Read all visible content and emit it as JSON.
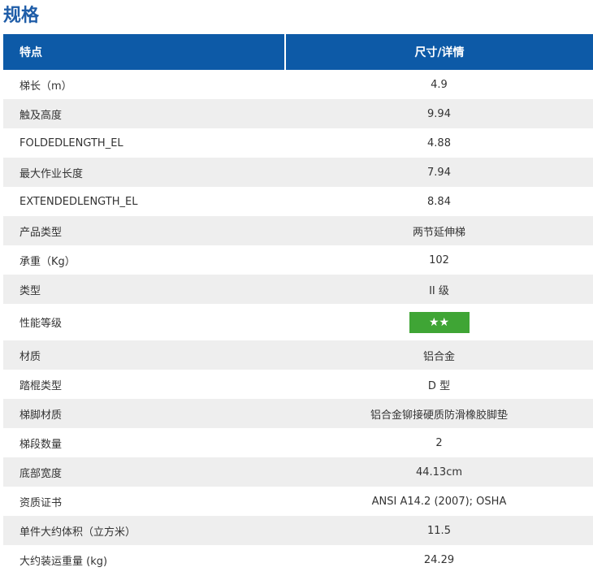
{
  "page_title": "规格",
  "table": {
    "header_feature": "特点",
    "header_detail": "尺寸/详情",
    "rows": [
      {
        "feature": "梯长（m）",
        "detail": "4.9"
      },
      {
        "feature": "触及高度",
        "detail": "9.94"
      },
      {
        "feature": "FOLDEDLENGTH_EL",
        "detail": "4.88"
      },
      {
        "feature": "最大作业长度",
        "detail": "7.94"
      },
      {
        "feature": "EXTENDEDLENGTH_EL",
        "detail": "8.84"
      },
      {
        "feature": "产品类型",
        "detail": "两节延伸梯"
      },
      {
        "feature": "承重（Kg）",
        "detail": "102"
      },
      {
        "feature": "类型",
        "detail": "II 级"
      },
      {
        "feature": "性能等级",
        "detail": "★★",
        "rating_color": "#3fa535",
        "rating_stars": 2
      },
      {
        "feature": "材质",
        "detail": "铝合金"
      },
      {
        "feature": "踏棍类型",
        "detail": "D 型"
      },
      {
        "feature": "梯脚材质",
        "detail": "铝合金铆接硬质防滑橡胶脚垫"
      },
      {
        "feature": "梯段数量",
        "detail": "2"
      },
      {
        "feature": "底部宽度",
        "detail": "44.13cm"
      },
      {
        "feature": "资质证书",
        "detail": "ANSI A14.2 (2007); OSHA"
      },
      {
        "feature": "单件大约体积（立方米）",
        "detail": "11.5"
      },
      {
        "feature": "大约装运重量 (kg)",
        "detail": "24.29"
      }
    ]
  },
  "colors": {
    "title": "#1f5da8",
    "header_bg": "#0d5aa7",
    "stripe": "#eeeeee",
    "rating_badge": "#3fa535"
  }
}
